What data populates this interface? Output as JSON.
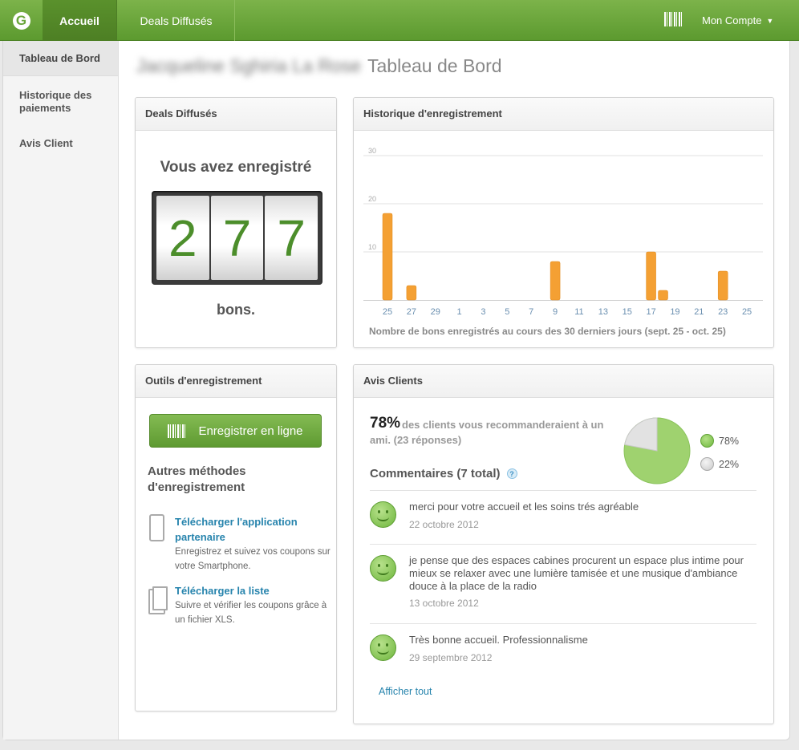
{
  "nav": {
    "logo": "G",
    "tabs": [
      {
        "label": "Accueil"
      },
      {
        "label": "Deals Diffusés"
      }
    ],
    "account_label": "Mon Compte",
    "caret": "▼"
  },
  "sidebar": {
    "items": [
      {
        "label": "Tableau de Bord"
      },
      {
        "label": "Historique des paiements"
      },
      {
        "label": "Avis Client"
      }
    ]
  },
  "page": {
    "merchant_name": "Jacqueline Sghiria La Rose",
    "title": "Tableau de Bord"
  },
  "deals_panel": {
    "title": "Deals Diffusés",
    "line1": "Vous avez enregistré",
    "digits": [
      "2",
      "7",
      "7"
    ],
    "line2": "bons."
  },
  "history_panel": {
    "title": "Historique d'enregistrement",
    "caption": "Nombre de bons enregistrés au cours des 30 derniers jours (sept. 25 - oct. 25)"
  },
  "chart_data": {
    "type": "bar",
    "title": "",
    "xlabel": "Nombre de bons enregistrés au cours des 30 derniers jours (sept. 25 - oct. 25)",
    "ylabel": "",
    "ylim": [
      0,
      30
    ],
    "yticks": [
      10,
      20,
      30
    ],
    "grid": true,
    "color": "#f4a033",
    "x_ticks": [
      "25",
      "27",
      "29",
      "1",
      "3",
      "5",
      "7",
      "9",
      "11",
      "13",
      "15",
      "17",
      "19",
      "21",
      "23",
      "25"
    ],
    "categories": [
      "25",
      "26",
      "27",
      "28",
      "29",
      "30",
      "1",
      "2",
      "3",
      "4",
      "5",
      "6",
      "7",
      "8",
      "9",
      "10",
      "11",
      "12",
      "13",
      "14",
      "15",
      "16",
      "17",
      "18",
      "19",
      "20",
      "21",
      "22",
      "23",
      "24",
      "25"
    ],
    "values": [
      18,
      0,
      3,
      0,
      0,
      0,
      0,
      0,
      0,
      0,
      0,
      0,
      0,
      0,
      8,
      0,
      0,
      0,
      0,
      0,
      0,
      0,
      10,
      2,
      0,
      0,
      0,
      0,
      6,
      0,
      0
    ]
  },
  "tools_panel": {
    "title": "Outils d'enregistrement",
    "button_label": "Enregistrer en ligne",
    "other_title": "Autres méthodes d'enregistrement",
    "items": [
      {
        "link": "Télécharger l'application partenaire",
        "desc": "Enregistrez et suivez vos coupons sur votre Smartphone."
      },
      {
        "link": "Télécharger la liste",
        "desc": "Suivre et vérifier les coupons grâce à un fichier XLS."
      }
    ]
  },
  "avis_panel": {
    "title": "Avis Clients",
    "percent": "78%",
    "percent_text": "des clients vous recommanderaient à un ami. (23 réponses)",
    "pie": {
      "positive": 78,
      "neutral": 22,
      "positive_color": "#9fd26f",
      "neutral_color": "#e2e2e2"
    },
    "legend": [
      {
        "label": "78%"
      },
      {
        "label": "22%"
      }
    ],
    "comments_title": "Commentaires (7 total)",
    "help": "?",
    "comments": [
      {
        "text": "merci pour votre accueil et les soins trés agréable",
        "date": "22 octobre 2012"
      },
      {
        "text": "je pense que des espaces cabines procurent un espace plus intime pour mieux se relaxer avec une lumière tamisée et une musique d'ambiance douce à la place de la radio",
        "date": "13 octobre 2012"
      },
      {
        "text": "Très bonne accueil. Professionnalisme",
        "date": "29 septembre 2012"
      }
    ],
    "show_all": "Afficher tout"
  }
}
